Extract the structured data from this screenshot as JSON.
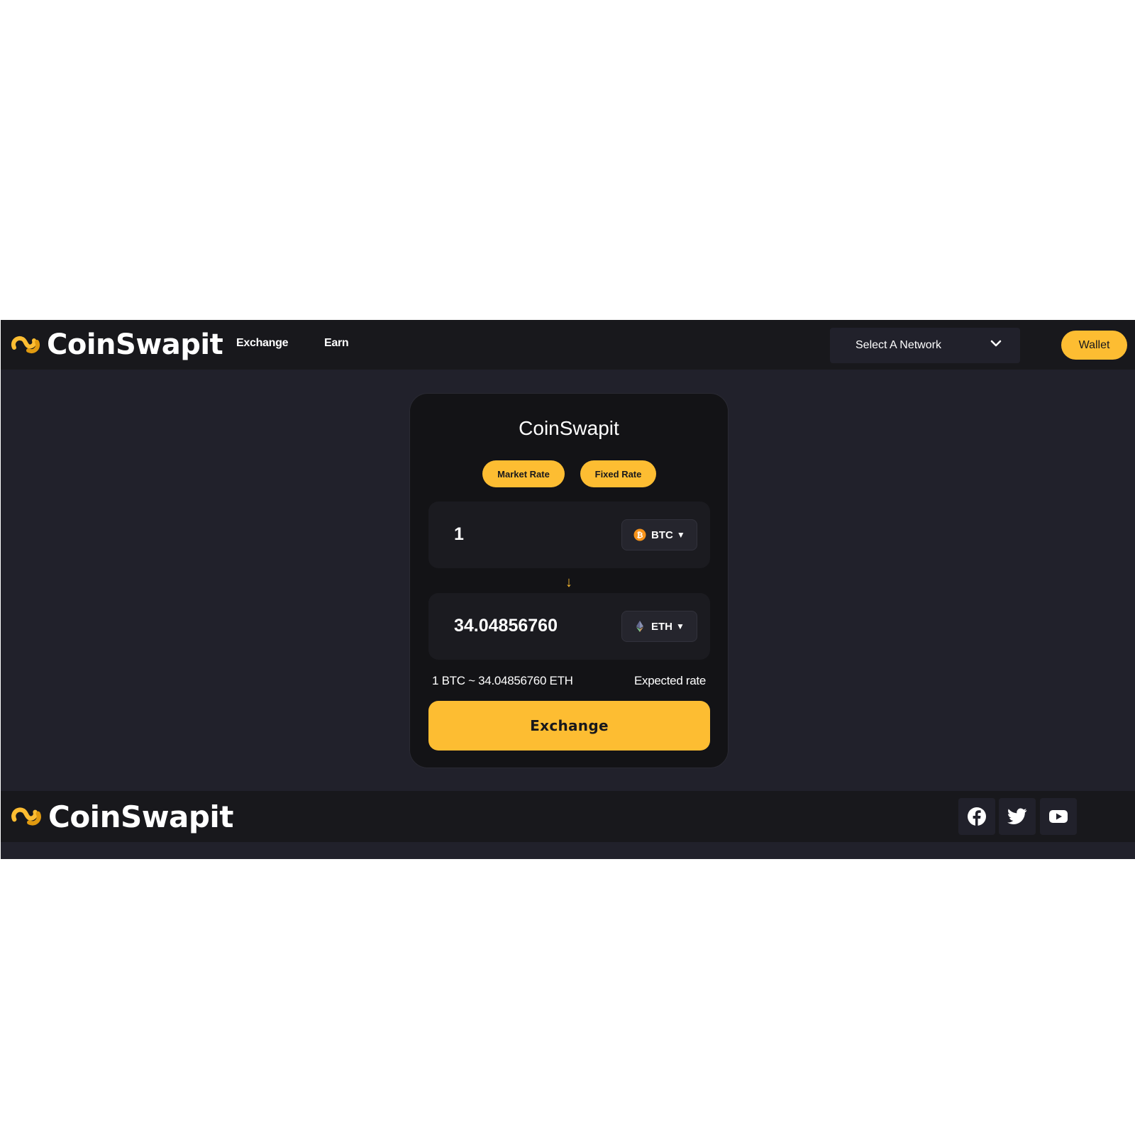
{
  "header": {
    "brand": "CoinSwapit",
    "nav": [
      {
        "label": "Exchange"
      },
      {
        "label": "Earn"
      }
    ],
    "network_select": "Select A Network",
    "wallet_label": "Wallet"
  },
  "card": {
    "title": "CoinSwapit",
    "rate_types": [
      "Market Rate",
      "Fixed Rate"
    ],
    "from": {
      "amount": "1",
      "coin": "BTC",
      "icon": "bitcoin-icon"
    },
    "swap_arrow": "↓",
    "to": {
      "amount": "34.04856760",
      "coin": "ETH",
      "icon": "ethereum-icon"
    },
    "rate_text": "1 BTC ~ 34.04856760 ETH",
    "rate_label": "Expected rate",
    "exchange_label": "Exchange"
  },
  "footer": {
    "brand": "CoinSwapit",
    "social": [
      "facebook-icon",
      "twitter-icon",
      "youtube-icon"
    ]
  },
  "colors": {
    "accent": "#fdbd32",
    "header_bg": "#18181c",
    "page_bg": "#21212b",
    "card_bg": "#131316",
    "bitcoin": "#f7931a"
  }
}
